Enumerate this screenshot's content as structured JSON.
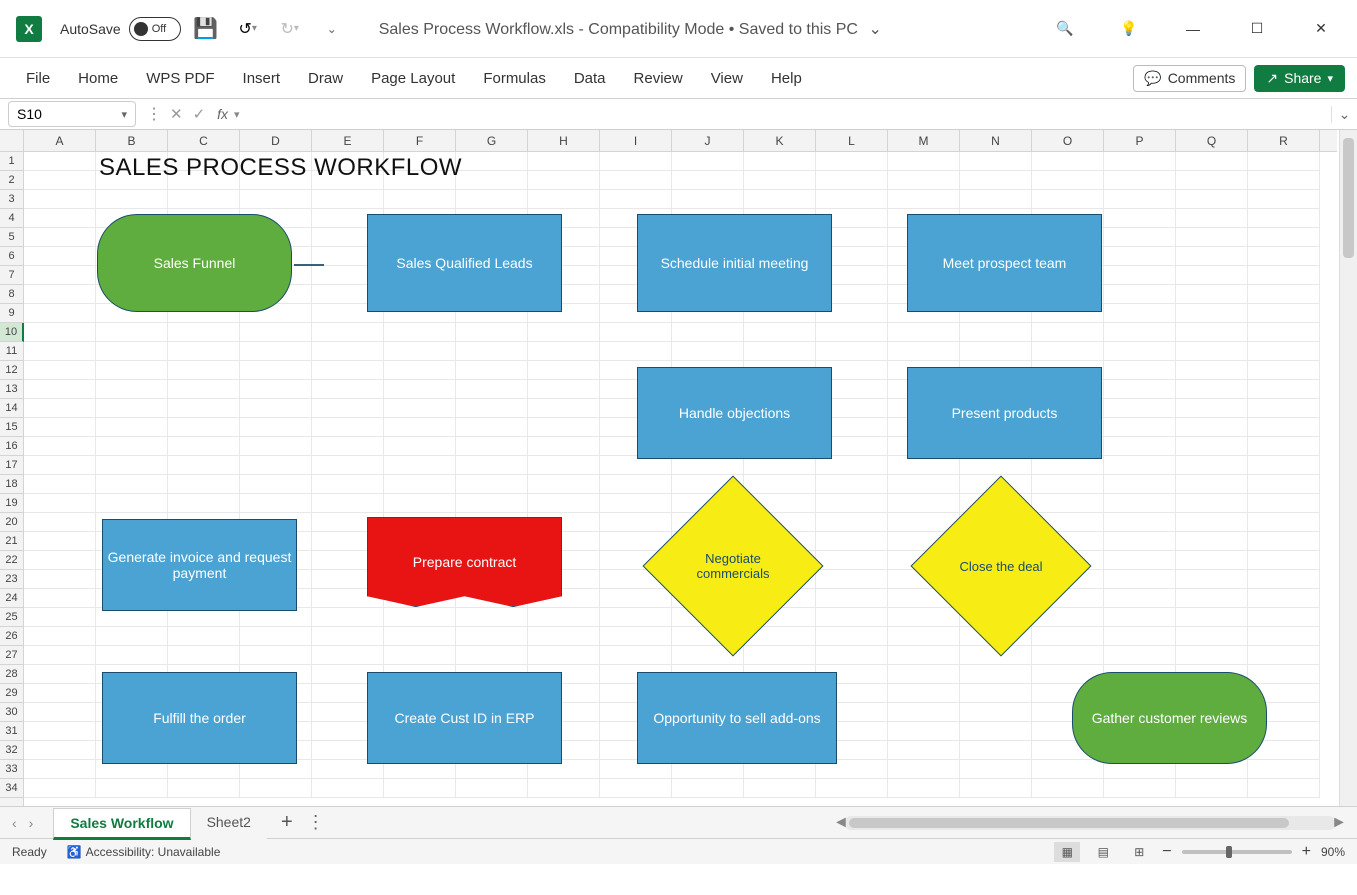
{
  "titlebar": {
    "app_icon": "X",
    "autosave_label": "AutoSave",
    "autosave_state": "Off",
    "document_title": "Sales Process Workflow.xls  -  Compatibility Mode • Saved to this PC"
  },
  "menu": {
    "items": [
      "File",
      "Home",
      "WPS PDF",
      "Insert",
      "Draw",
      "Page Layout",
      "Formulas",
      "Data",
      "Review",
      "View",
      "Help"
    ],
    "comments": "Comments",
    "share": "Share"
  },
  "formula": {
    "name_box": "S10",
    "fx": "fx",
    "value": ""
  },
  "grid": {
    "columns": [
      "A",
      "B",
      "C",
      "D",
      "E",
      "F",
      "G",
      "H",
      "I",
      "J",
      "K",
      "L",
      "M",
      "N",
      "O",
      "P",
      "Q",
      "R"
    ],
    "row_count": 34,
    "selected_row": 10
  },
  "flowchart": {
    "title": "SALES PROCESS WORKFLOW",
    "shapes": {
      "start": "Sales Funnel",
      "qualified": "Sales Qualified Leads",
      "schedule": "Schedule initial meeting",
      "meet": "Meet prospect team",
      "present": "Present products",
      "handle": "Handle objections",
      "negotiate": "Negotiate commercials",
      "close": "Close the deal",
      "prepare": "Prepare contract",
      "invoice": "Generate invoice and request payment",
      "custid": "Create Cust ID in ERP",
      "fulfill": "Fulfill the order",
      "addons": "Opportunity to sell add-ons",
      "reviews": "Gather customer reviews"
    }
  },
  "tabs": {
    "sheets": [
      "Sales Workflow",
      "Sheet2"
    ],
    "active": 0
  },
  "status": {
    "ready": "Ready",
    "accessibility": "Accessibility: Unavailable",
    "zoom": "90%"
  },
  "chart_data": {
    "type": "table",
    "title": "SALES PROCESS WORKFLOW",
    "nodes": [
      {
        "id": "start",
        "label": "Sales Funnel",
        "shape": "terminator"
      },
      {
        "id": "qualified",
        "label": "Sales Qualified Leads",
        "shape": "process"
      },
      {
        "id": "schedule",
        "label": "Schedule initial meeting",
        "shape": "process"
      },
      {
        "id": "meet",
        "label": "Meet prospect team",
        "shape": "process"
      },
      {
        "id": "present",
        "label": "Present products",
        "shape": "process"
      },
      {
        "id": "handle",
        "label": "Handle objections",
        "shape": "process"
      },
      {
        "id": "negotiate",
        "label": "Negotiate commercials",
        "shape": "decision"
      },
      {
        "id": "close",
        "label": "Close the deal",
        "shape": "decision"
      },
      {
        "id": "prepare",
        "label": "Prepare contract",
        "shape": "document"
      },
      {
        "id": "invoice",
        "label": "Generate invoice and request payment",
        "shape": "process"
      },
      {
        "id": "custid",
        "label": "Create Cust ID in ERP",
        "shape": "process"
      },
      {
        "id": "fulfill",
        "label": "Fulfill the order",
        "shape": "process"
      },
      {
        "id": "addons",
        "label": "Opportunity to sell add-ons",
        "shape": "process"
      },
      {
        "id": "reviews",
        "label": "Gather customer reviews",
        "shape": "terminator"
      }
    ],
    "edges": [
      [
        "start",
        "qualified"
      ],
      [
        "qualified",
        "schedule"
      ],
      [
        "schedule",
        "meet"
      ],
      [
        "meet",
        "present"
      ],
      [
        "present",
        "handle"
      ],
      [
        "handle",
        "negotiate"
      ],
      [
        "handle",
        "close"
      ],
      [
        "handle",
        "invoice_branch"
      ],
      [
        "negotiate",
        "prepare"
      ],
      [
        "negotiate",
        "addons"
      ],
      [
        "close",
        "addons"
      ],
      [
        "close",
        "reviews"
      ],
      [
        "prepare",
        "custid"
      ],
      [
        "custid",
        "fulfill"
      ],
      [
        "fulfill",
        "invoice"
      ],
      [
        "invoice",
        "fulfill_loop"
      ]
    ]
  }
}
